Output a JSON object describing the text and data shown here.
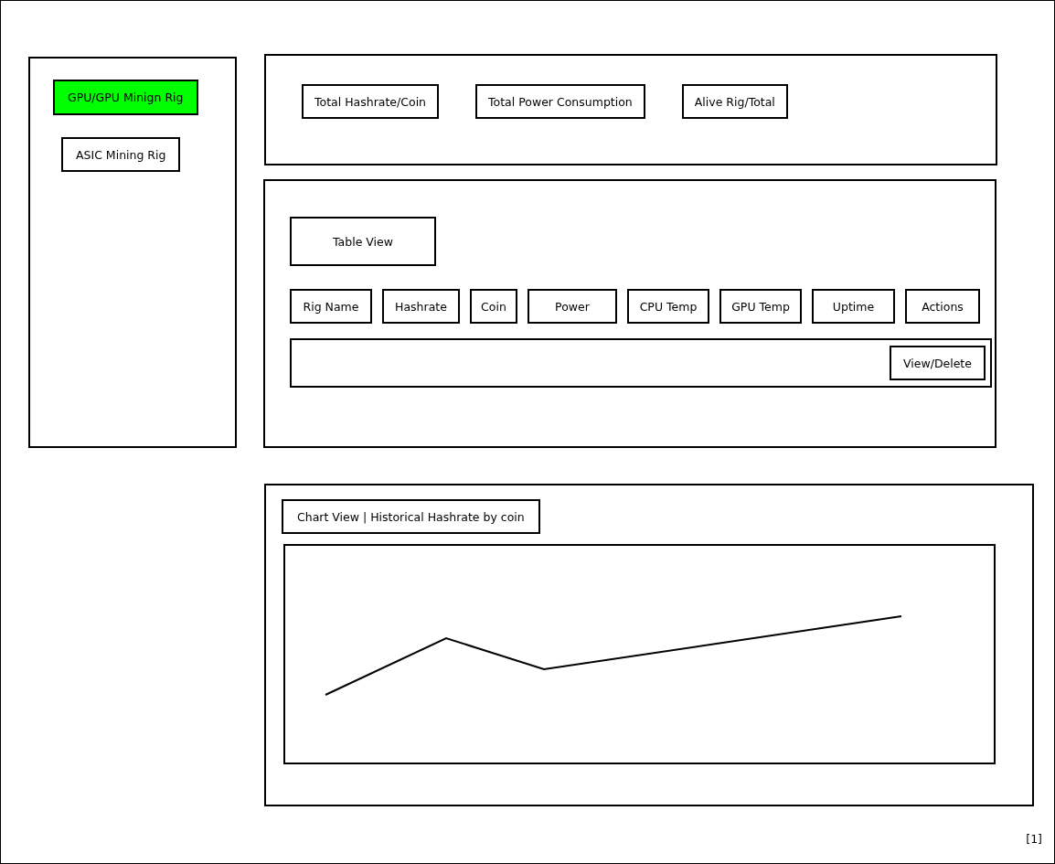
{
  "sidebar": {
    "items": [
      {
        "label": "GPU/GPU Minign Rig",
        "selected": true
      },
      {
        "label": "ASIC Mining Rig",
        "selected": false
      }
    ]
  },
  "summary": {
    "cards": [
      "Total Hashrate/Coin",
      "Total Power Consumption",
      "Alive Rig/Total"
    ]
  },
  "table_panel": {
    "title": "Table View",
    "columns": [
      "Rig Name",
      "Hashrate",
      "Coin",
      "Power",
      "CPU Temp",
      "GPU Temp",
      "Uptime",
      "Actions"
    ],
    "rows": [
      {
        "action": "View/Delete"
      }
    ]
  },
  "chart_panel": {
    "title": "Chart View | Historical Hashrate by coin"
  },
  "footnote": "[1]"
}
